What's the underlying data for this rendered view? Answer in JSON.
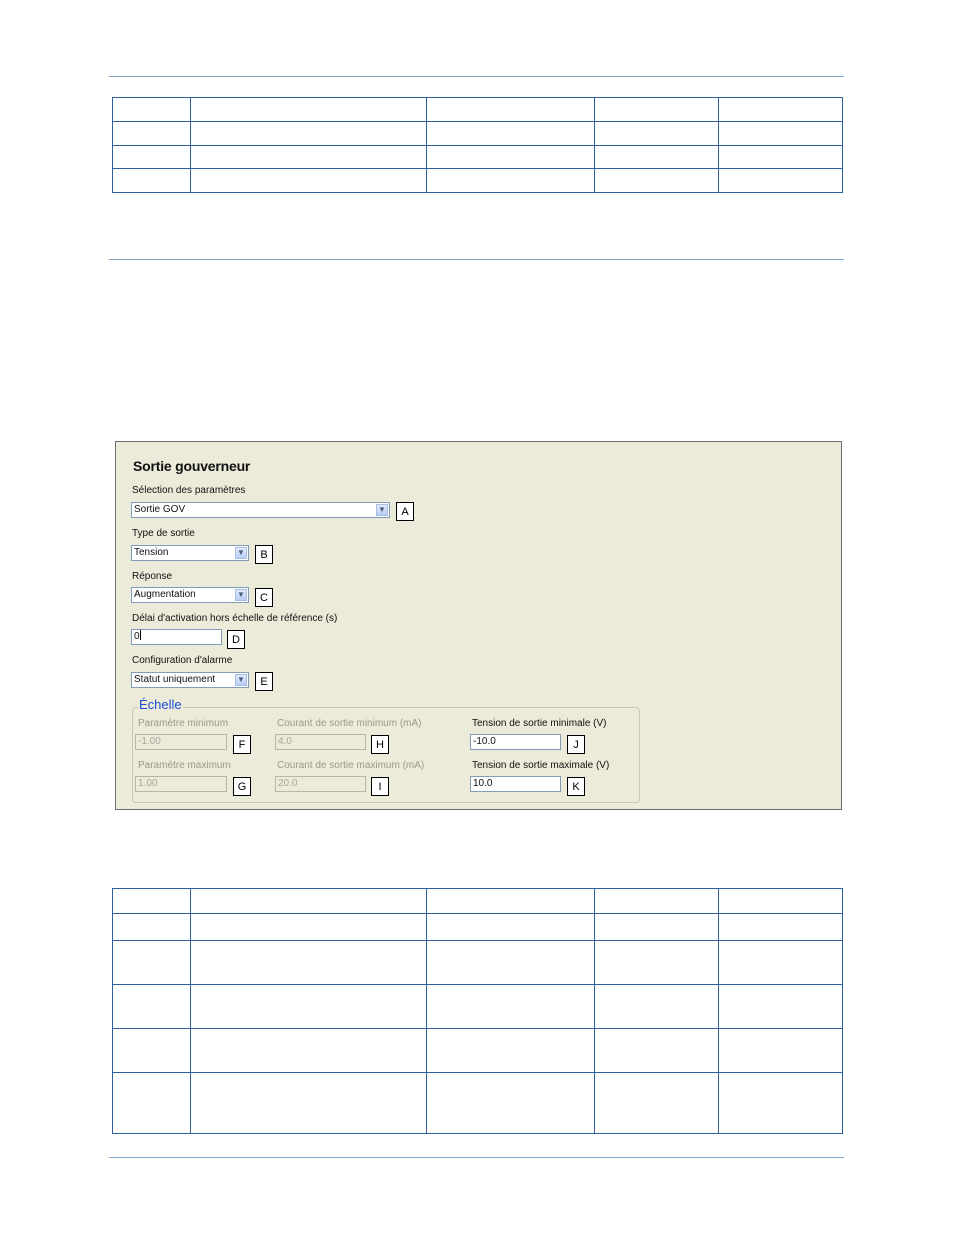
{
  "panel": {
    "title": "Sortie gouverneur",
    "param_selection": {
      "label": "Sélection des paramètres",
      "value": "Sortie GOV",
      "callout": "A"
    },
    "output_type": {
      "label": "Type de sortie",
      "value": "Tension",
      "callout": "B"
    },
    "response": {
      "label": "Réponse",
      "value": "Augmentation",
      "callout": "C"
    },
    "delay": {
      "label": "Délai d'activation hors échelle de référence (s)",
      "value": "0",
      "callout": "D"
    },
    "alarm_config": {
      "label": "Configuration d'alarme",
      "value": "Statut uniquement",
      "callout": "E"
    },
    "scale": {
      "legend": "Échelle",
      "param_min": {
        "label": "Paramètre minimum",
        "value": "-1.00",
        "callout": "F"
      },
      "param_max": {
        "label": "Paramètre maximum",
        "value": "1.00",
        "callout": "G"
      },
      "current_min": {
        "label": "Courant de sortie minimum (mA)",
        "value": "4.0",
        "callout": "H"
      },
      "current_max": {
        "label": "Courant de sortie maximum (mA)",
        "value": "20.0",
        "callout": "I"
      },
      "voltage_min": {
        "label": "Tension de sortie minimale (V)",
        "value": "-10.0",
        "callout": "J"
      },
      "voltage_max": {
        "label": "Tension de sortie maximale (V)",
        "value": "10.0",
        "callout": "K"
      }
    }
  },
  "colors": {
    "rule": "#7fa7cc",
    "table_border": "#2f5f9f",
    "panel_bg": "#ecead9",
    "legend_text": "#1c4fd6"
  }
}
